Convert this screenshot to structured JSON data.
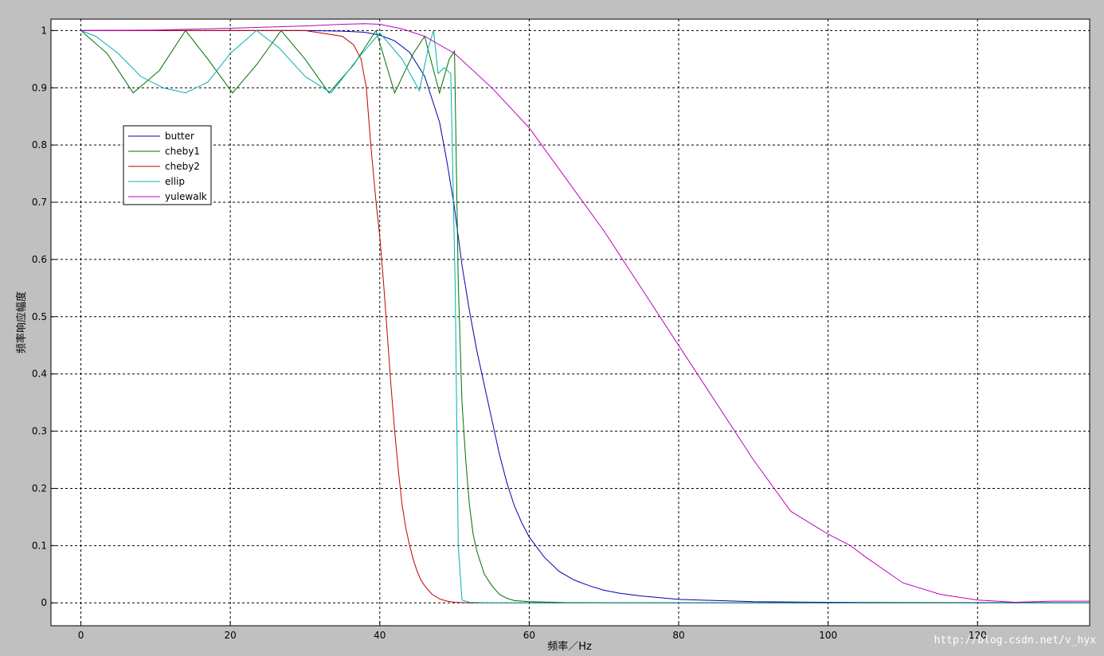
{
  "chart_data": {
    "type": "line",
    "xlabel": "频率／Hz",
    "ylabel": "频率响应幅度",
    "xlim": [
      -4,
      135
    ],
    "ylim": [
      -0.04,
      1.02
    ],
    "xticks": [
      0,
      20,
      40,
      60,
      80,
      100,
      120
    ],
    "yticks": [
      0,
      0.1,
      0.2,
      0.3,
      0.4,
      0.5,
      0.6,
      0.7,
      0.8,
      0.9,
      1
    ],
    "grid": true,
    "legend_position": "upper-left",
    "series": [
      {
        "name": "butter",
        "color": "#0000b0",
        "x": [
          0,
          10,
          20,
          30,
          35,
          38,
          40,
          42,
          44,
          46,
          48,
          49,
          50,
          51,
          52,
          53,
          54,
          55,
          56,
          57,
          58,
          59,
          60,
          62,
          64,
          66,
          68,
          70,
          72,
          75,
          80,
          90,
          100,
          110,
          120,
          135
        ],
        "y": [
          1,
          1,
          1,
          1,
          0.999,
          0.997,
          0.992,
          0.982,
          0.962,
          0.92,
          0.84,
          0.77,
          0.69,
          0.59,
          0.51,
          0.44,
          0.38,
          0.32,
          0.26,
          0.21,
          0.17,
          0.14,
          0.115,
          0.08,
          0.055,
          0.04,
          0.03,
          0.022,
          0.017,
          0.012,
          0.006,
          0.002,
          0.001,
          0.0005,
          0.0002,
          0
        ]
      },
      {
        "name": "cheby1",
        "color": "#007000",
        "x": [
          0,
          3.5,
          7,
          10.5,
          14,
          17,
          20.3,
          23.5,
          26.8,
          30,
          33.2,
          36.5,
          39.5,
          42,
          44.5,
          46,
          48,
          49.3,
          50,
          50.5,
          51,
          51.5,
          52,
          52.5,
          53,
          54,
          55,
          56,
          57,
          58,
          60,
          65,
          80,
          100,
          135
        ],
        "y": [
          1,
          0.96,
          0.891,
          0.93,
          1,
          0.95,
          0.891,
          0.94,
          1,
          0.95,
          0.891,
          0.94,
          1,
          0.891,
          0.96,
          0.99,
          0.891,
          0.95,
          0.964,
          0.56,
          0.35,
          0.25,
          0.17,
          0.12,
          0.09,
          0.05,
          0.03,
          0.015,
          0.008,
          0.004,
          0.002,
          0.0005,
          0,
          0,
          0
        ]
      },
      {
        "name": "cheby2",
        "color": "#c00000",
        "x": [
          0,
          10,
          20,
          30,
          35,
          36.5,
          37.5,
          38.2,
          38.8,
          39.5,
          40,
          40.5,
          41,
          41.5,
          42,
          42.5,
          43,
          43.5,
          44,
          44.5,
          45,
          45.5,
          46,
          47,
          48,
          49,
          50,
          52,
          60,
          80,
          100,
          106,
          120,
          135
        ],
        "y": [
          1,
          1,
          1,
          1,
          0.99,
          0.975,
          0.95,
          0.9,
          0.8,
          0.7,
          0.64,
          0.56,
          0.47,
          0.38,
          0.3,
          0.23,
          0.17,
          0.13,
          0.1,
          0.075,
          0.055,
          0.04,
          0.03,
          0.015,
          0.007,
          0.003,
          0.001,
          0,
          0,
          0,
          0,
          0.0005,
          0.0005,
          0.0003
        ]
      },
      {
        "name": "ellip",
        "color": "#00b0b0",
        "x": [
          0,
          2,
          5,
          8,
          11,
          14,
          17,
          20,
          23.5,
          26.5,
          30,
          33.5,
          37,
          40,
          43,
          45.3,
          46.5,
          47.2,
          47.8,
          48.6,
          49.5,
          50.1,
          50.5,
          51,
          52,
          55,
          60,
          80,
          100,
          135
        ],
        "y": [
          1,
          0.99,
          0.96,
          0.92,
          0.9,
          0.891,
          0.91,
          0.96,
          1,
          0.97,
          0.92,
          0.891,
          0.95,
          0.996,
          0.95,
          0.895,
          0.97,
          1,
          0.925,
          0.935,
          0.925,
          0.55,
          0.1,
          0.005,
          0.001,
          0,
          0,
          0,
          0,
          0
        ]
      },
      {
        "name": "yulewalk",
        "color": "#c000c0",
        "x": [
          0,
          10,
          20,
          30,
          35,
          38,
          40,
          43,
          46,
          50,
          55,
          60,
          65,
          70,
          75,
          80,
          85,
          90,
          95,
          100,
          103,
          105,
          110,
          115,
          120,
          125,
          130,
          135
        ],
        "y": [
          1,
          1.001,
          1.004,
          1.008,
          1.011,
          1.012,
          1.011,
          1.003,
          0.99,
          0.96,
          0.9,
          0.83,
          0.74,
          0.65,
          0.55,
          0.45,
          0.35,
          0.25,
          0.16,
          0.12,
          0.1,
          0.08,
          0.035,
          0.015,
          0.005,
          0.001,
          0.003,
          0.003
        ]
      }
    ]
  },
  "watermark": "http://blog.csdn.net/v_hyx"
}
